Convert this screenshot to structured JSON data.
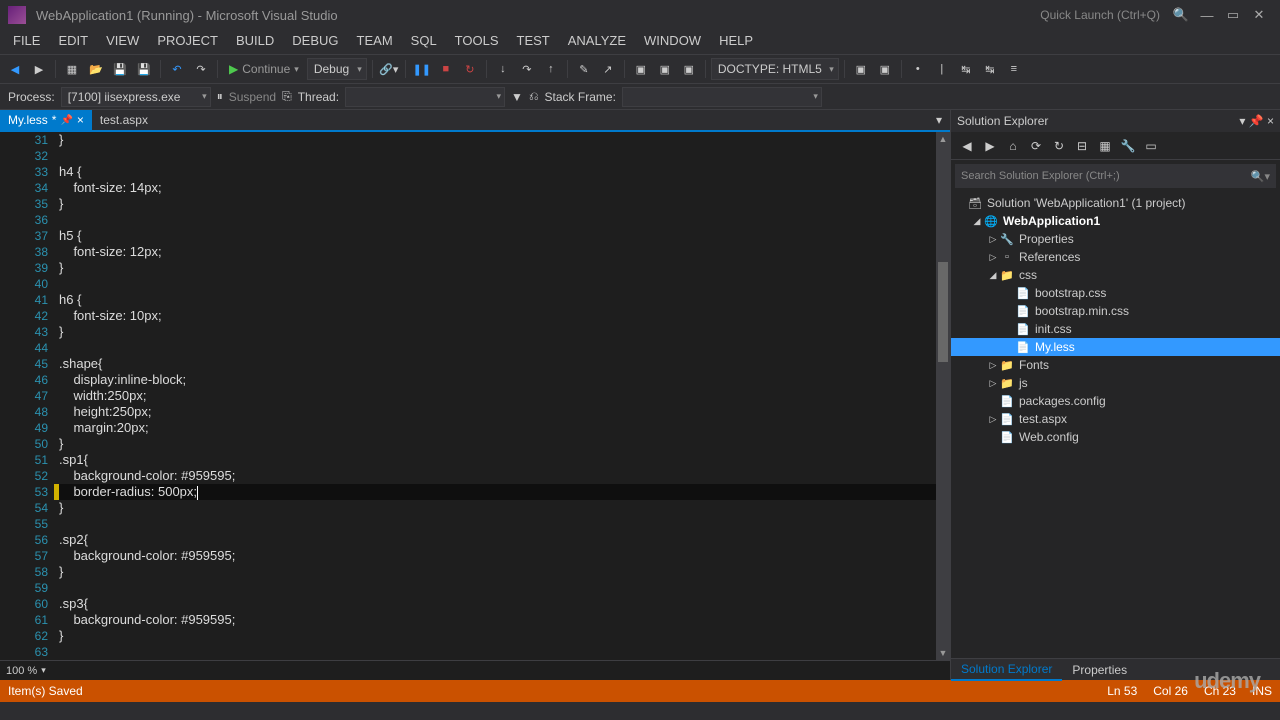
{
  "titlebar": {
    "title": "WebApplication1 (Running) - Microsoft Visual Studio",
    "quickLaunch": "Quick Launch (Ctrl+Q)"
  },
  "menu": [
    "FILE",
    "EDIT",
    "VIEW",
    "PROJECT",
    "BUILD",
    "DEBUG",
    "TEAM",
    "SQL",
    "TOOLS",
    "TEST",
    "ANALYZE",
    "WINDOW",
    "HELP"
  ],
  "toolbar": {
    "continue": "Continue",
    "debug": "Debug",
    "doctype": "DOCTYPE: HTML5"
  },
  "procbar": {
    "process": "Process:",
    "procval": "[7100] iisexpress.exe",
    "suspend": "Suspend",
    "thread": "Thread:",
    "stackframe": "Stack Frame:"
  },
  "tabs": {
    "active": "My.less",
    "modified": "*",
    "other": "test.aspx"
  },
  "code": {
    "firstLine": 31,
    "lines": [
      "}",
      "",
      "h4 {",
      "    font-size: 14px;",
      "}",
      "",
      "h5 {",
      "    font-size: 12px;",
      "}",
      "",
      "h6 {",
      "    font-size: 10px;",
      "}",
      "",
      ".shape{",
      "    display:inline-block;",
      "    width:250px;",
      "    height:250px;",
      "    margin:20px;",
      "}",
      ".sp1{",
      "    background-color: #959595;",
      "    border-radius: 500px;",
      "}",
      "",
      ".sp2{",
      "    background-color: #959595;",
      "}",
      "",
      ".sp3{",
      "    background-color: #959595;",
      "}",
      "",
      ""
    ],
    "currentLineIndex": 22,
    "modifiedLines": [
      22
    ]
  },
  "zoom": "100 %",
  "se": {
    "title": "Solution Explorer",
    "search": "Search Solution Explorer (Ctrl+;)",
    "solution": "Solution 'WebApplication1' (1 project)",
    "project": "WebApplication1",
    "nodes": {
      "props": "Properties",
      "refs": "References",
      "css": "css",
      "files": [
        "bootstrap.css",
        "bootstrap.min.css",
        "init.css",
        "My.less"
      ],
      "fonts": "Fonts",
      "js": "js",
      "pkg": "packages.config",
      "test": "test.aspx",
      "web": "Web.config"
    },
    "selected": "My.less"
  },
  "panels": {
    "se": "Solution Explorer",
    "props": "Properties"
  },
  "status": {
    "msg": "Item(s) Saved",
    "ln": "Ln 53",
    "col": "Col 26",
    "ch": "Ch 23",
    "ins": "INS"
  },
  "watermark": "udemy"
}
